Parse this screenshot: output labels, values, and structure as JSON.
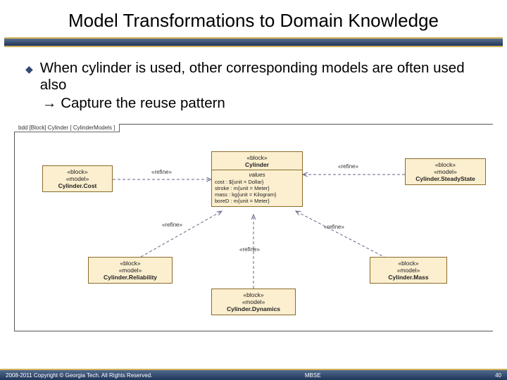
{
  "title": "Model Transformations to Domain Knowledge",
  "bullet": "When cylinder is used, other corresponding models are often used also",
  "followup_arrow": "→",
  "followup": "Capture the reuse pattern",
  "diagram": {
    "tab": "bdd [Block] Cylinder [ CylinderModels ]",
    "blocks": {
      "cost": {
        "s1": "«block»",
        "s2": "«model»",
        "name": "Cylinder.Cost"
      },
      "center": {
        "s1": "«block»",
        "name": "Cylinder",
        "valhdr": "values",
        "v1": "cost : ${unit = Dollar}",
        "v2": "stroke : m{unit = Meter}",
        "v3": "mass : kg{unit = Kilogram}",
        "v4": "boreD : m{unit = Meter}"
      },
      "steady": {
        "s1": "«block»",
        "s2": "«model»",
        "name": "Cylinder.SteadyState"
      },
      "rel": {
        "s1": "«block»",
        "s2": "«model»",
        "name": "Cylinder.Reliability"
      },
      "dyn": {
        "s1": "«block»",
        "s2": "«model»",
        "name": "Cylinder.Dynamics"
      },
      "mass": {
        "s1": "«block»",
        "s2": "«model»",
        "name": "Cylinder.Mass"
      }
    },
    "labels": {
      "refine": "«refine»"
    }
  },
  "footer": {
    "left": "2008-2011 Copyright © Georgia Tech. All Rights Reserved.",
    "center": "MBSE",
    "right": "40"
  }
}
